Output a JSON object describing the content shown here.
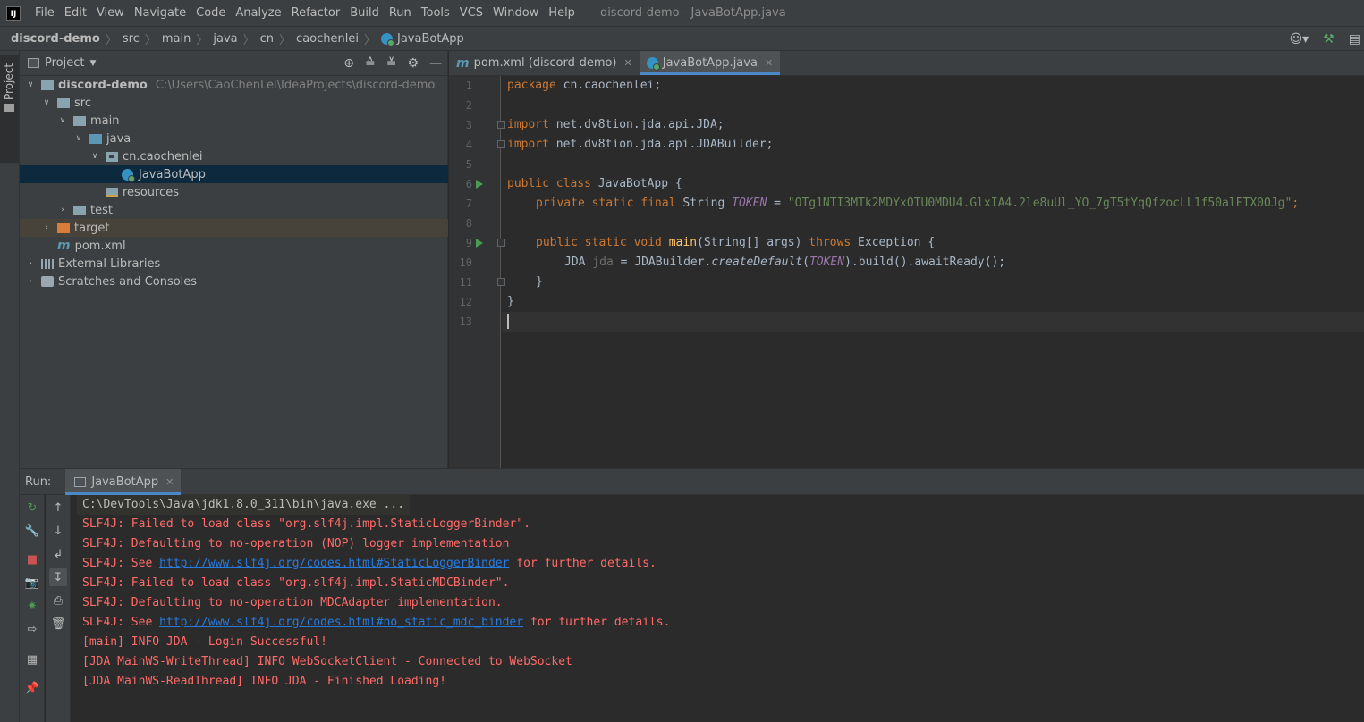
{
  "menu": {
    "logo": "IJ",
    "items": [
      "File",
      "Edit",
      "View",
      "Navigate",
      "Code",
      "Analyze",
      "Refactor",
      "Build",
      "Run",
      "Tools",
      "VCS",
      "Window",
      "Help"
    ],
    "title": "discord-demo - JavaBotApp.java"
  },
  "breadcrumb": [
    "discord-demo",
    "src",
    "main",
    "java",
    "cn",
    "caochenlei",
    "JavaBotApp"
  ],
  "stripe": {
    "project_label": "Project"
  },
  "project": {
    "title": "Project",
    "tree": [
      {
        "label": "discord-demo",
        "path": "C:\\Users\\CaoChenLei\\IdeaProjects\\discord-demo",
        "icon": "folder-icon"
      },
      {
        "label": "src",
        "icon": "folder-icon"
      },
      {
        "label": "main",
        "icon": "folder-icon"
      },
      {
        "label": "java",
        "icon": "source-folder-icon"
      },
      {
        "label": "cn.caochenlei",
        "icon": "package-icon"
      },
      {
        "label": "JavaBotApp",
        "icon": "java-class-icon"
      },
      {
        "label": "resources",
        "icon": "resources-folder-icon"
      },
      {
        "label": "test",
        "icon": "folder-icon"
      },
      {
        "label": "target",
        "icon": "excluded-folder-icon"
      },
      {
        "label": "pom.xml",
        "icon": "maven-icon"
      },
      {
        "label": "External Libraries",
        "icon": "libraries-icon"
      },
      {
        "label": "Scratches and Consoles",
        "icon": "scratches-icon"
      }
    ]
  },
  "editor": {
    "tabs": [
      {
        "label": "pom.xml (discord-demo)",
        "icon": "maven-icon"
      },
      {
        "label": "JavaBotApp.java",
        "icon": "java-class-icon"
      }
    ],
    "line_numbers": [
      "1",
      "2",
      "3",
      "4",
      "5",
      "6",
      "7",
      "8",
      "9",
      "10",
      "11",
      "12",
      "13"
    ],
    "code": {
      "l1_kw": "package",
      "l1_rest": " cn.caochenlei;",
      "l3_kw": "import",
      "l3_rest": " net.dv8tion.jda.api.JDA;",
      "l4_kw": "import",
      "l4_rest": " net.dv8tion.jda.api.JDABuilder;",
      "l6_kw": "public class",
      "l6_rest": " JavaBotApp {",
      "l7_kw": "private static final",
      "l7_type": " String ",
      "l7_field": "TOKEN",
      "l7_eq": " = ",
      "l7_str": "\"OTg1NTI3MTk2MDYxOTU0MDU4.GlxIA4.2le8uUl_YO_7gT5tYqQfzocLL1f50alETX0OJg\"",
      "l7_end": ";",
      "l9_kw": "public static void",
      "l9_fn": "main",
      "l9_args": "(String[] args) ",
      "l9_kw2": "throws",
      "l9_rest": " Exception {",
      "l10_type": "JDA ",
      "l10_var": "jda",
      "l10_eq": " = JDABuilder.",
      "l10_fn": "createDefault",
      "l10_open": "(",
      "l10_arg": "TOKEN",
      "l10_rest": ").build().awaitReady();",
      "l11": "}",
      "l12": "}"
    }
  },
  "run": {
    "label": "Run:",
    "tab": "JavaBotApp",
    "console": {
      "c1": "C:\\DevTools\\Java\\jdk1.8.0_311\\bin\\java.exe ...",
      "c2": "SLF4J: Failed to load class \"org.slf4j.impl.StaticLoggerBinder\".",
      "c3": "SLF4J: Defaulting to no-operation (NOP) logger implementation",
      "c4_pre": "SLF4J: See ",
      "c4_link": "http://www.slf4j.org/codes.html#StaticLoggerBinder",
      "c4_post": " for further details.",
      "c5": "SLF4J: Failed to load class \"org.slf4j.impl.StaticMDCBinder\".",
      "c6": "SLF4J: Defaulting to no-operation MDCAdapter implementation.",
      "c7_pre": "SLF4J: See ",
      "c7_link": "http://www.slf4j.org/codes.html#no_static_mdc_binder",
      "c7_post": " for further details.",
      "c8": "[main] INFO JDA - Login Successful!",
      "c9": "[JDA MainWS-WriteThread] INFO WebSocketClient - Connected to WebSocket",
      "c10": "[JDA MainWS-ReadThread] INFO JDA - Finished Loading!"
    }
  },
  "colors": {
    "background": "#2b2b2b",
    "panel": "#3c3f41",
    "keyword": "#cc7832",
    "string": "#6a8759",
    "field": "#9876aa",
    "function": "#ffc66d",
    "error_text": "#ff6b68",
    "link": "#287bde",
    "selection": "#0d293e",
    "accent": "#4a88c7"
  }
}
